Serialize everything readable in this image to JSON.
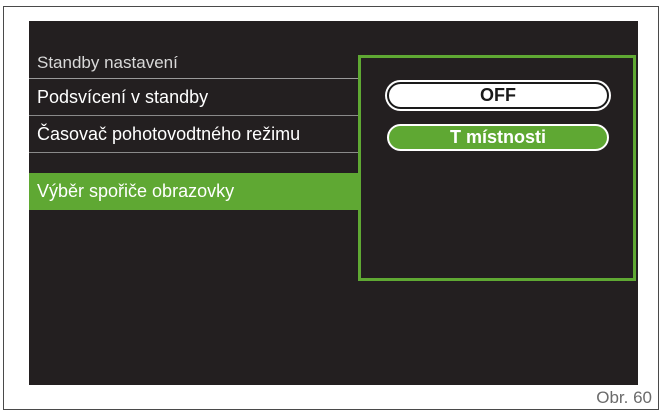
{
  "menu": {
    "title": "Standby nastavení",
    "items": [
      {
        "label": "Podsvícení v standby"
      },
      {
        "label": "Časovač pohotovodtného režimu"
      },
      {
        "label": "Výběr spořiče obrazovky"
      }
    ]
  },
  "popup": {
    "options": [
      {
        "label": "OFF"
      },
      {
        "label": "T místnosti"
      }
    ]
  },
  "caption": "Obr. 60",
  "colors": {
    "accent_green": "#5fa833",
    "screen_background": "#231f20"
  }
}
